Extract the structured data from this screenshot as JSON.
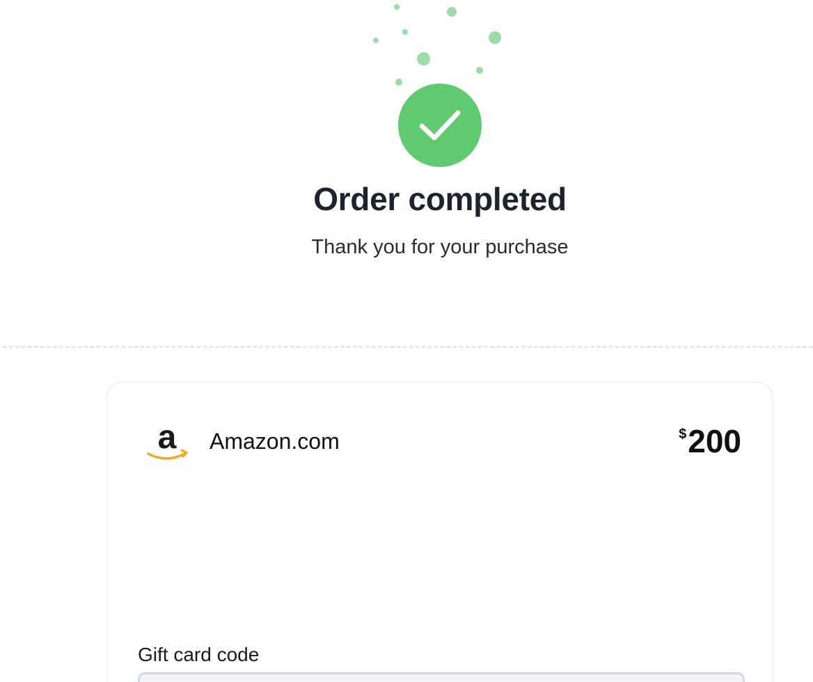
{
  "confirmation": {
    "title": "Order completed",
    "subtitle": "Thank you for your purchase",
    "status_icon": "checkmark-circle-icon",
    "accent_color": "#5fca70",
    "confetti_color": "#9bdcaa"
  },
  "order_card": {
    "merchant": {
      "name": "Amazon.com",
      "logo_icon": "amazon-logo-icon",
      "logo_letter": "a",
      "logo_arrow_color": "#f5a623"
    },
    "price": {
      "currency_symbol": "$",
      "amount": "200"
    },
    "gift_card": {
      "label": "Gift card code",
      "value": ""
    }
  }
}
